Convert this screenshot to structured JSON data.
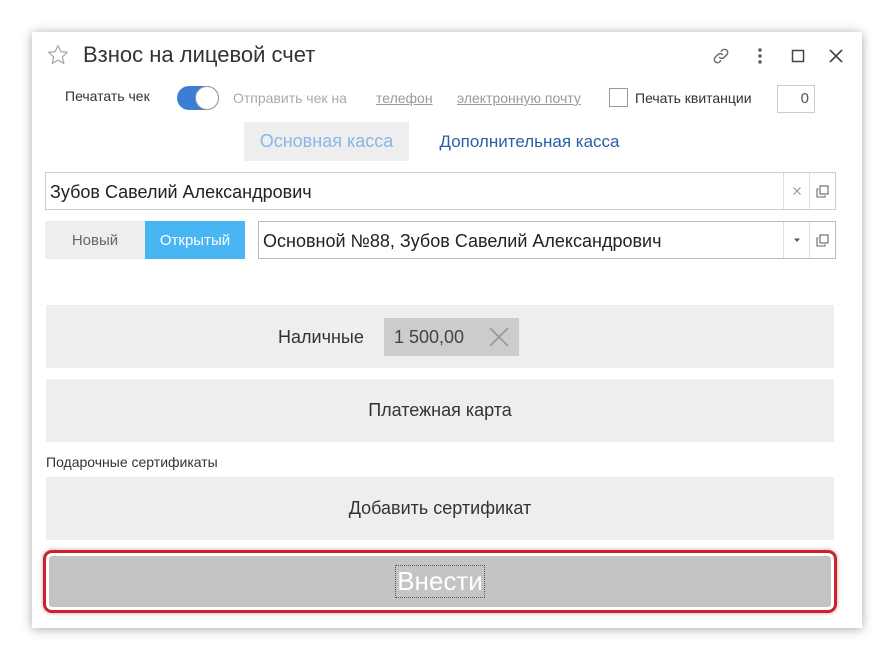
{
  "window": {
    "title": "Взнос на лицевой счет",
    "icons": [
      "star-icon",
      "link-icon",
      "more-vertical-icon",
      "maximize-icon",
      "close-icon"
    ]
  },
  "options": {
    "print_check_label": "Печатать чек",
    "print_check_on": true,
    "send_check_label": "Отправить чек на",
    "phone_link": "телефон",
    "email_link": "электронную почту",
    "print_receipts_label": "Печать квитанции",
    "print_receipts_checked": false,
    "receipts_count": "0"
  },
  "tabs": {
    "main": "Основная касса",
    "extra": "Дополнительная касса",
    "active": "main"
  },
  "client": {
    "value": "Зубов Савелий Александрович"
  },
  "account": {
    "new_label": "Новый",
    "open_label": "Открытый",
    "selected": "open",
    "value": "Основной №88, Зубов Савелий Александрович"
  },
  "payment": {
    "cash_label": "Наличные",
    "cash_amount": "1 500,00",
    "card_label": "Платежная карта",
    "gift_section_label": "Подарочные сертификаты",
    "add_certificate_label": "Добавить сертификат"
  },
  "submit": {
    "label": "Внести"
  },
  "colors": {
    "accent_blue": "#3a7fd5",
    "open_segment": "#47b6f3",
    "highlight_red": "#d2202a",
    "link_blue": "#2a5fa8"
  }
}
